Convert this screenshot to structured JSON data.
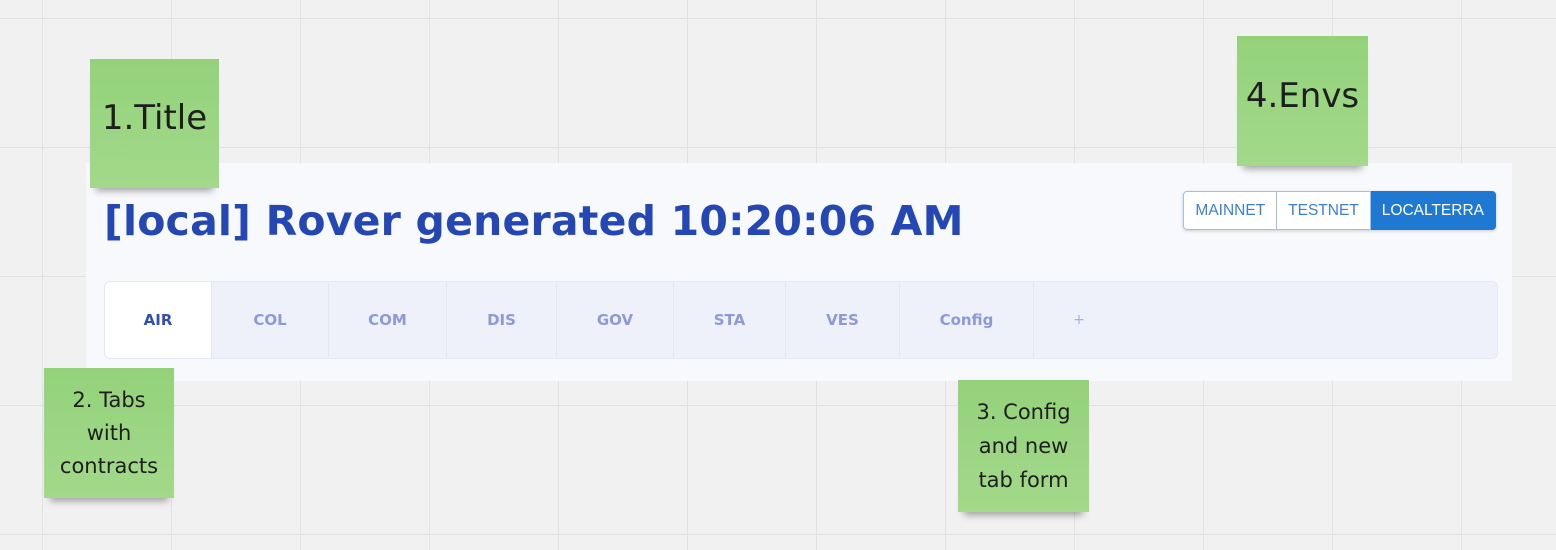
{
  "header": {
    "title": "[local] Rover generated 10:20:06 AM"
  },
  "environments": [
    {
      "label": "MAINNET",
      "active": false
    },
    {
      "label": "TESTNET",
      "active": false
    },
    {
      "label": "LOCALTERRA",
      "active": true
    }
  ],
  "tabs": [
    {
      "label": "AIR",
      "active": true
    },
    {
      "label": "COL",
      "active": false
    },
    {
      "label": "COM",
      "active": false
    },
    {
      "label": "DIS",
      "active": false
    },
    {
      "label": "GOV",
      "active": false
    },
    {
      "label": "STA",
      "active": false
    },
    {
      "label": "VES",
      "active": false
    },
    {
      "label": "Config",
      "active": false
    },
    {
      "label": "+",
      "active": false
    }
  ],
  "notes": {
    "title": "1.Title",
    "tabs": "2. Tabs with contracts",
    "config": "3. Config and new tab form",
    "envs": "4.Envs"
  },
  "colors": {
    "title": "#2547b3",
    "env_active": "#1f78d1",
    "note": "#9ad582",
    "canvas": "#f1f1f1"
  }
}
